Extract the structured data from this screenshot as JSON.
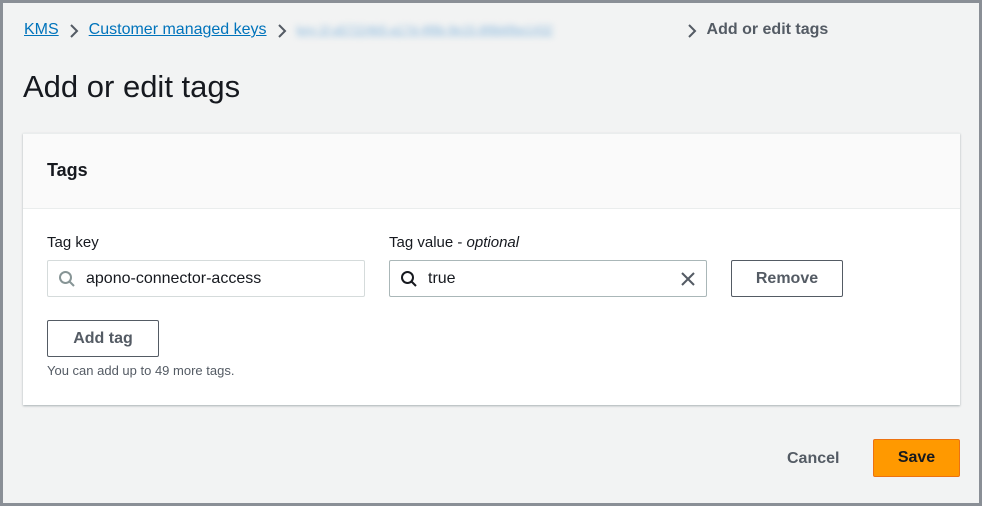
{
  "breadcrumb": {
    "kms": "KMS",
    "customer_keys": "Customer managed keys",
    "key_id": "key-1f-a57224b5-a17d-4f8b-9e15-8f8b6fbe1432",
    "current": "Add or edit tags"
  },
  "page_title": "Add or edit tags",
  "tags_panel": {
    "title": "Tags",
    "key_label": "Tag key",
    "value_label_main": "Tag value - ",
    "value_label_optional": "optional",
    "rows": [
      {
        "key": "apono-connector-access",
        "value": "true",
        "remove_label": "Remove"
      }
    ],
    "add_tag_label": "Add tag",
    "hint": "You can add up to 49 more tags."
  },
  "footer": {
    "cancel_label": "Cancel",
    "save_label": "Save"
  },
  "colors": {
    "link": "#0073bb",
    "primary_button": "#ff9900",
    "background": "#f2f3f3"
  }
}
